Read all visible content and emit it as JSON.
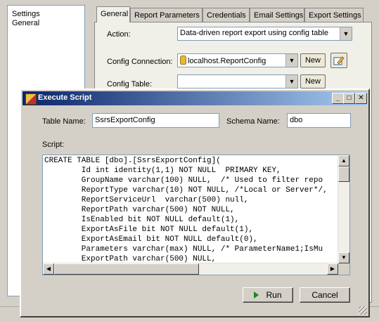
{
  "tree": {
    "items": [
      "Settings",
      "General"
    ]
  },
  "tabs": [
    {
      "label": "General",
      "active": true
    },
    {
      "label": "Report Parameters",
      "active": false
    },
    {
      "label": "Credentials",
      "active": false
    },
    {
      "label": "Email Settings",
      "active": false
    },
    {
      "label": "Export Settings",
      "active": false
    }
  ],
  "general": {
    "action_label": "Action:",
    "action_value": "Data-driven report export using config table",
    "config_connection_label": "Config Connection:",
    "config_connection_value": "localhost.ReportConfig",
    "new_label": "New",
    "config_table_label": "Config Table:",
    "config_table_value": ""
  },
  "dialog": {
    "title": "Execute Script",
    "table_name_label": "Table Name:",
    "table_name_value": "SsrsExportConfig",
    "schema_name_label": "Schema Name:",
    "schema_name_value": "dbo",
    "script_label": "Script:",
    "script_lines": [
      "CREATE TABLE [dbo].[SsrsExportConfig](",
      "        Id int identity(1,1) NOT NULL  PRIMARY KEY,",
      "        GroupName varchar(100) NULL,  /* Used to filter repo",
      "        ReportType varchar(10) NOT NULL, /*Local or Server*/,",
      "        ReportServiceUrl  varchar(500) null,",
      "        ReportPath varchar(500) NOT NULL,",
      "        IsEnabled bit NOT NULL default(1),",
      "        ExportAsFile bit NOT NULL default(1),",
      "        ExportAsEmail bit NOT NULL default(0),",
      "        Parameters varchar(max) NULL, /* ParameterName1;IsMu",
      "        ExportPath varchar(500) NULL,"
    ],
    "run_label": "Run",
    "cancel_label": "Cancel"
  },
  "icons": {
    "app": "execute-script-icon",
    "database": "database-icon",
    "edit": "edit-connection-icon",
    "run": "play-icon"
  }
}
